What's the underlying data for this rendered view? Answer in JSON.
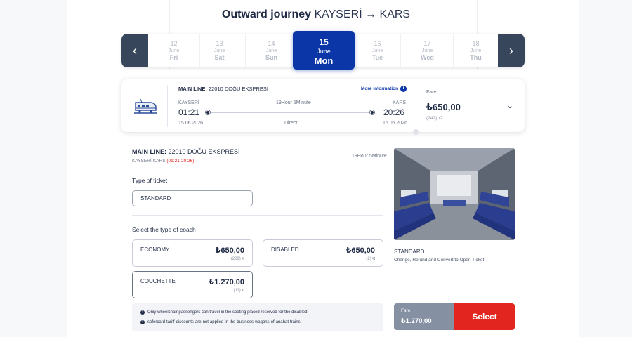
{
  "header": {
    "title": "Outward journey",
    "route": "KAYSERİ → KARS"
  },
  "dates": [
    {
      "num": "12",
      "month": "June",
      "wd": "Fri"
    },
    {
      "num": "13",
      "month": "June",
      "wd": "Sat"
    },
    {
      "num": "14",
      "month": "June",
      "wd": "Sun"
    },
    {
      "num": "15",
      "month": "June",
      "wd": "Mon"
    },
    {
      "num": "16",
      "month": "June",
      "wd": "Tue"
    },
    {
      "num": "17",
      "month": "June",
      "wd": "Wed"
    },
    {
      "num": "18",
      "month": "June",
      "wd": "Thu"
    }
  ],
  "train": {
    "line_label": "MAIN LINE:",
    "line_name": "22010 DOĞU EKSPRESİ",
    "more_info": "More information",
    "from": "KAYSERİ",
    "to": "KARS",
    "dep_time": "01:21",
    "arr_time": "20:26",
    "duration": "19Hour 5Minute",
    "dep_date": "15.06.2026",
    "arr_date": "15.06.2026",
    "type": "Direct",
    "fare_label": "Fare",
    "fare": "₺650,00",
    "seats": "(242)"
  },
  "detail": {
    "line_label": "MAIN LINE:",
    "line_name": "22010 DOĞU EKSPRESİ",
    "route": "KAYSERİ-KARS",
    "times": "(01:21-20:26)",
    "duration": "19Hour 5Minute",
    "ticket_heading": "Type of ticket",
    "ticket_value": "STANDARD",
    "coach_heading": "Select the type of coach",
    "coaches": [
      {
        "name": "ECONOMY",
        "price": "₺650,00",
        "count": "(229)"
      },
      {
        "name": "DISABLED",
        "price": "₺650,00",
        "count": "(2)"
      },
      {
        "name": "COUCHETTE",
        "price": "₺1.270,00",
        "count": "(11)"
      }
    ],
    "photo_title": "STANDARD",
    "photo_desc": "Change, Refund and Convert to Open Ticket",
    "notes": [
      "Only wheelchair passengers can travel in the seating placed reserved for the disabled.",
      "sefercard-tariff-discounts-are-not-applied-in-the-business-wagons-of-anahat-trains"
    ],
    "fare_label": "Fare",
    "fare_value": "₺1.270,00",
    "select_label": "Select"
  }
}
